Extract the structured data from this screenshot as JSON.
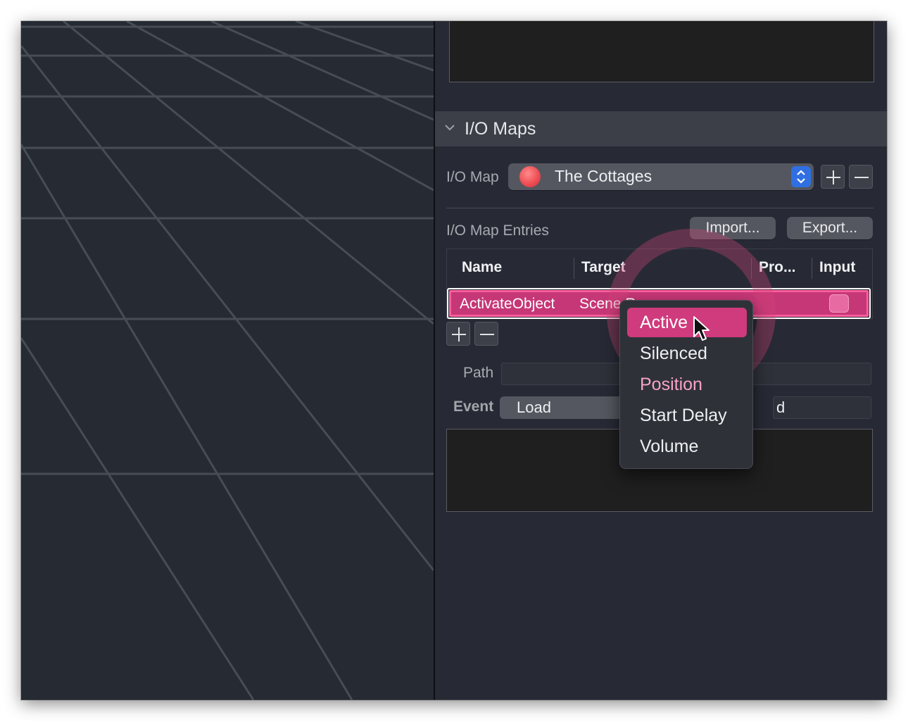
{
  "inspector": {
    "io_maps_section": {
      "title": "I/O Maps",
      "io_map_label": "I/O Map",
      "io_map_value": "The Cottages",
      "entries_label": "I/O Map Entries",
      "import_label": "Import...",
      "export_label": "Export..."
    },
    "table": {
      "columns": [
        "Name",
        "Target",
        "Pro...",
        "Input"
      ],
      "rows": [
        {
          "name": "ActivateObject",
          "target": "Scene Ro"
        }
      ]
    },
    "path_label": "Path",
    "event_label": "Event",
    "event_value": "Load",
    "event_right_fragment": "d"
  },
  "context_menu": {
    "items": [
      "Active",
      "Silenced",
      "Position",
      "Start Delay",
      "Volume"
    ],
    "selected": "Active"
  },
  "colors": {
    "accent": "#c63777",
    "selection": "#cf3b7c",
    "stepper": "#2f6fe2",
    "background": "#272a35"
  }
}
